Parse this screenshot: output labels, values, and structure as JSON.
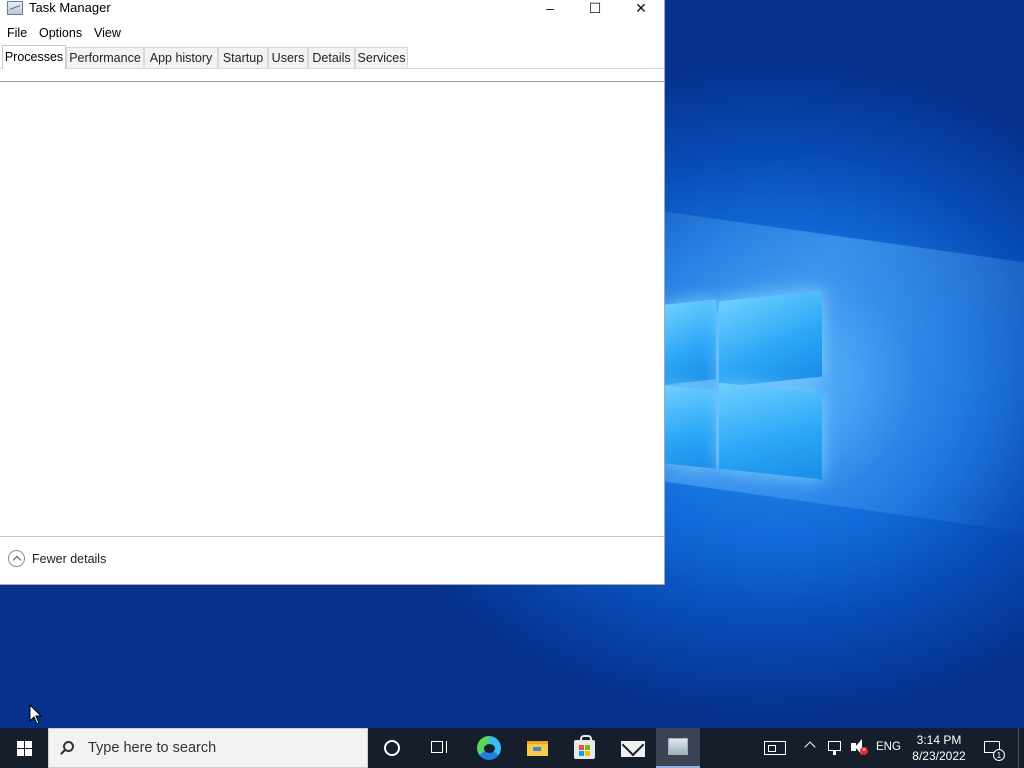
{
  "window": {
    "title": "Task Manager",
    "controls": {
      "minimize": "–",
      "maximize": "☐",
      "close": "✕"
    }
  },
  "menu": [
    "File",
    "Options",
    "View"
  ],
  "tabs": [
    {
      "label": "Processes",
      "active": true
    },
    {
      "label": "Performance",
      "active": false
    },
    {
      "label": "App history",
      "active": false
    },
    {
      "label": "Startup",
      "active": false
    },
    {
      "label": "Users",
      "active": false
    },
    {
      "label": "Details",
      "active": false
    },
    {
      "label": "Services",
      "active": false
    }
  ],
  "footer": {
    "fewer_details": "Fewer details"
  },
  "taskbar": {
    "search_placeholder": "Type here to search",
    "apps": [
      "cortana-icon",
      "task-view-icon",
      "edge-icon",
      "file-explorer-icon",
      "store-icon",
      "mail-icon",
      "task-manager-icon"
    ],
    "tray": {
      "language": "ENG",
      "time": "3:14 PM",
      "date": "8/23/2022",
      "notification_count": "1"
    }
  },
  "colors": {
    "desktop": "#0a4cc0",
    "taskbar": "#161e2b",
    "window": "#ffffff"
  }
}
